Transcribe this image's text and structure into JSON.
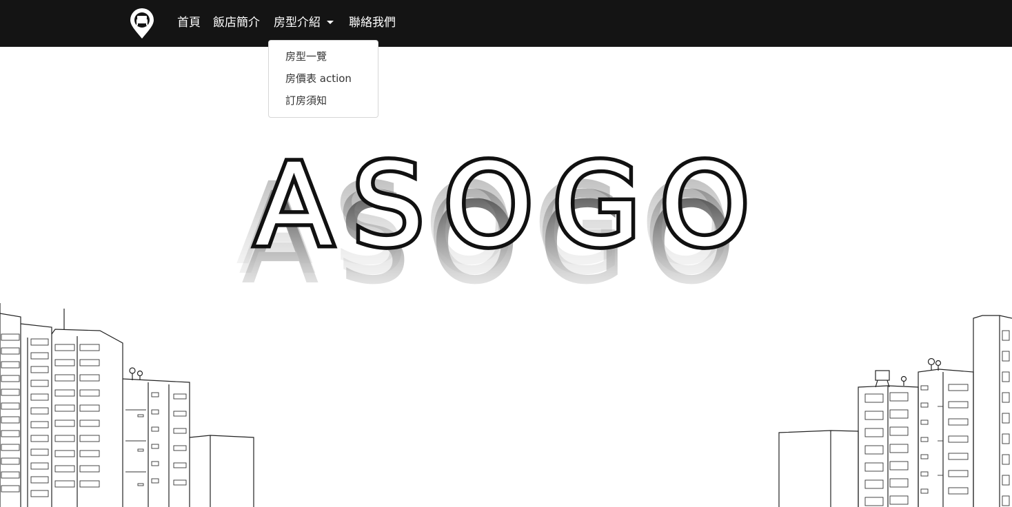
{
  "navbar": {
    "logo_icon": "map-pin-bed-icon",
    "items": [
      {
        "label": "首頁"
      },
      {
        "label": "飯店簡介"
      },
      {
        "label": "房型介紹"
      },
      {
        "label": "聯絡我們"
      }
    ]
  },
  "dropdown": {
    "open": true,
    "items": [
      {
        "label": "房型一覽"
      },
      {
        "label": "房價表 action"
      },
      {
        "label": "訂房須知"
      }
    ]
  },
  "hero": {
    "title": "ASOGO",
    "background": "city-skyline-illustration"
  },
  "colors": {
    "navbar_bg": "#141414",
    "nav_text": "#ffffff",
    "title": "#111111",
    "page_bg": "#ffffff"
  }
}
